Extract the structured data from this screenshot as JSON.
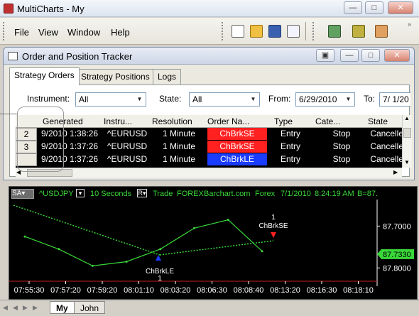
{
  "app": {
    "title": "MultiCharts - My",
    "icons": [
      "app-icon",
      "minimize-icon",
      "maximize-icon",
      "close-icon"
    ]
  },
  "menu": {
    "items": [
      "File",
      "View",
      "Window",
      "Help"
    ]
  },
  "toolbar": {
    "icons": [
      "new-document-icon",
      "open-folder-icon",
      "save-icon",
      "new-window-icon",
      "chart-icon",
      "scanner-icon",
      "settings-icon"
    ]
  },
  "tracker": {
    "title": "Order and Position Tracker",
    "tabs": [
      "Strategy Orders",
      "Strategy Positions",
      "Logs"
    ],
    "filters": {
      "instrument_label": "Instrument:",
      "instrument_value": "All",
      "state_label": "State:",
      "state_value": "All",
      "from_label": "From:",
      "from_value": "6/29/2010",
      "to_label": "To:",
      "to_value": "7/ 1/20"
    },
    "columns": [
      "Generated",
      "Instru...",
      "Resolution",
      "Order Na...",
      "Type",
      "Cate...",
      "State"
    ],
    "rows": [
      {
        "num": "2",
        "generated": "9/2010 1:38:26",
        "instrument": "^EURUSD",
        "resolution": "1 Minute",
        "order_name": "ChBrkSE",
        "order_color": "#ff2020",
        "type": "Entry",
        "category": "Stop",
        "state": "Cancelled"
      },
      {
        "num": "3",
        "generated": "9/2010 1:37:26",
        "instrument": "^EURUSD",
        "resolution": "1 Minute",
        "order_name": "ChBrkSE",
        "order_color": "#ff2020",
        "type": "Entry",
        "category": "Stop",
        "state": "Cancelled"
      },
      {
        "num": "",
        "generated": "9/2010 1:37:26",
        "instrument": "^EURUSD",
        "resolution": "1 Minute",
        "order_name": "ChBrkLE",
        "order_color": "#1a3cff",
        "type": "Entry",
        "category": "Stop",
        "state": "Cancelled"
      }
    ]
  },
  "chart": {
    "sa_label": "SA",
    "symbol": "^USDJPY",
    "interval": "10 Seconds",
    "type_label": "Trade",
    "category": "FOREX",
    "source": "Barchart.com",
    "market": "Forex",
    "date": "7/1/2010",
    "time": "8:24:19 AM",
    "extra": "B=87.",
    "price_ticks": [
      "87.8000",
      "87.7000"
    ],
    "last_price": "87.7330",
    "time_ticks": [
      "07:55:30",
      "07:57:20",
      "07:59:20",
      "08:01:10",
      "08:03:20",
      "08:06:30",
      "08:08:40",
      "08:13:20",
      "08:16:30",
      "08:18:10"
    ],
    "markers": [
      {
        "label": "ChBrkSE",
        "qty": "1",
        "color": "#ff2020"
      },
      {
        "label": "ChBrkLE",
        "qty": "1",
        "color": "#1a3cff"
      }
    ],
    "line_color": "#39d739",
    "accent_color": "#39d739"
  },
  "bottom_tabs": [
    "My",
    "John"
  ],
  "chart_data": {
    "type": "line",
    "x": [
      "07:55:30",
      "07:57:20",
      "07:59:20",
      "08:01:10",
      "08:03:20",
      "08:06:30",
      "08:08:40",
      "08:13:20"
    ],
    "series": [
      {
        "values": [
          87.775,
          87.745,
          87.705,
          87.715,
          87.745,
          87.795,
          87.815,
          87.74
        ]
      }
    ],
    "ylim": [
      87.67,
      87.86
    ],
    "yticks": [
      87.7,
      87.8
    ],
    "grid": false
  }
}
